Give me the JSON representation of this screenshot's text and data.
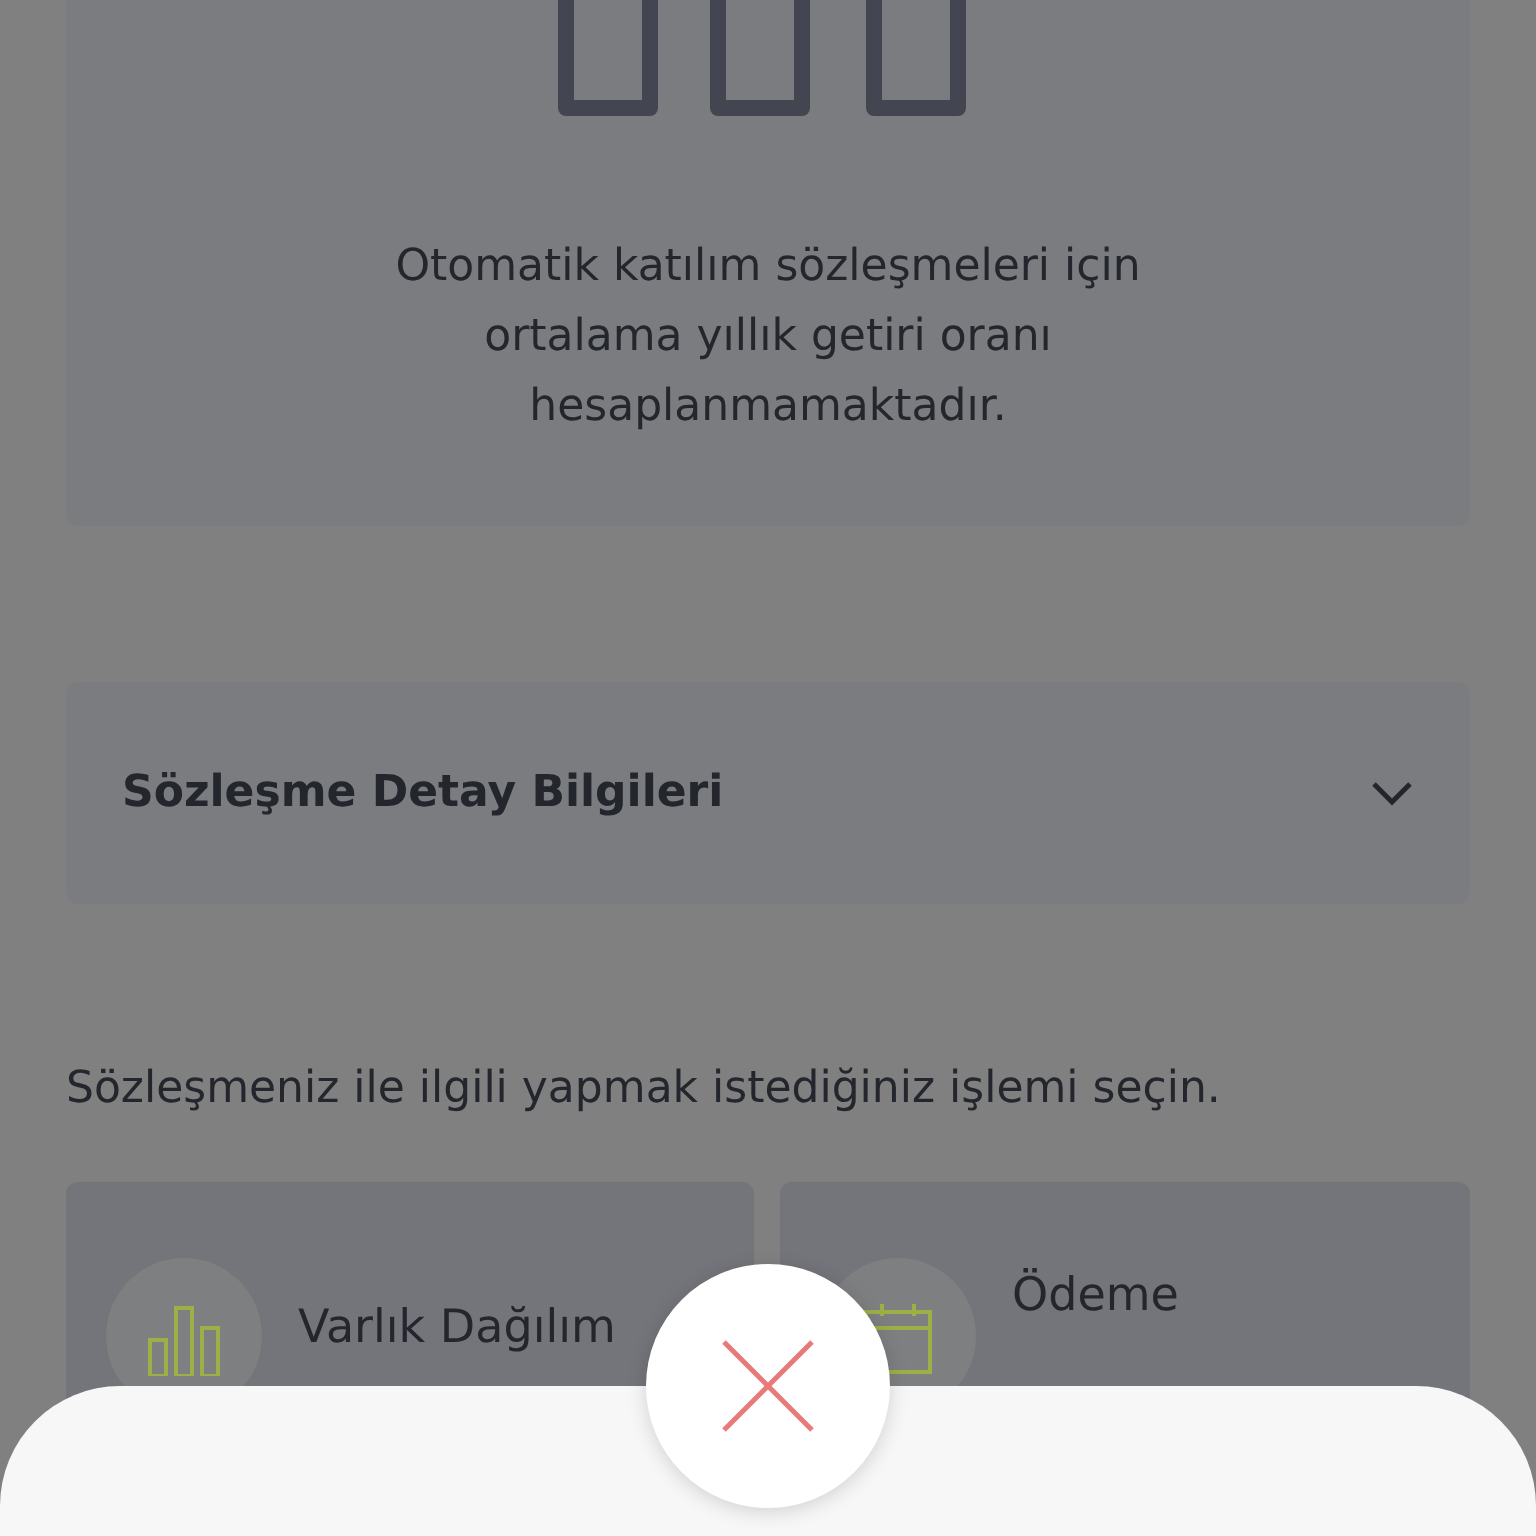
{
  "return_card": {
    "message": "Otomatik katılım sözleşmeleri için ortalama yıllık getiri oranı hesaplanmamaktadır."
  },
  "details_accordion": {
    "title": "Sözleşme Detay Bilgileri",
    "expanded": false
  },
  "prompt": "Sözleşmeniz ile ilgili yapmak istediğiniz işlemi seçin.",
  "actions": [
    {
      "kind": "chart",
      "label": "Varlık Dağılım"
    },
    {
      "kind": "calendar",
      "label": "Ödeme"
    }
  ]
}
